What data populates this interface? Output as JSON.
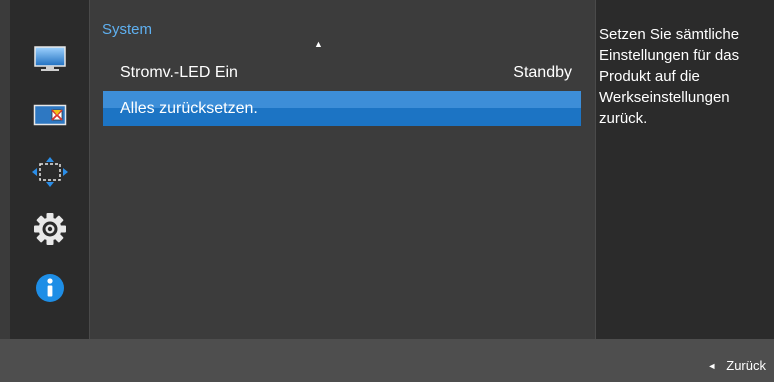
{
  "menu": {
    "title": "System",
    "items": [
      {
        "label": "Stromv.-LED Ein",
        "value": "Standby"
      },
      {
        "label": "Alles zurücksetzen."
      }
    ]
  },
  "help": {
    "text": "Setzen Sie sämtliche Einstellungen für das Produkt auf die Werkseinstellungen zurück."
  },
  "footer": {
    "back_label": "Zurück"
  },
  "icons": [
    {
      "name": "picture-icon"
    },
    {
      "name": "onscreen-display-icon"
    },
    {
      "name": "position-size-icon"
    },
    {
      "name": "system-gear-icon"
    },
    {
      "name": "information-icon"
    }
  ],
  "colors": {
    "accent": "#1c74c4",
    "title": "#5fb0f0",
    "info": "#1e8ee6"
  }
}
